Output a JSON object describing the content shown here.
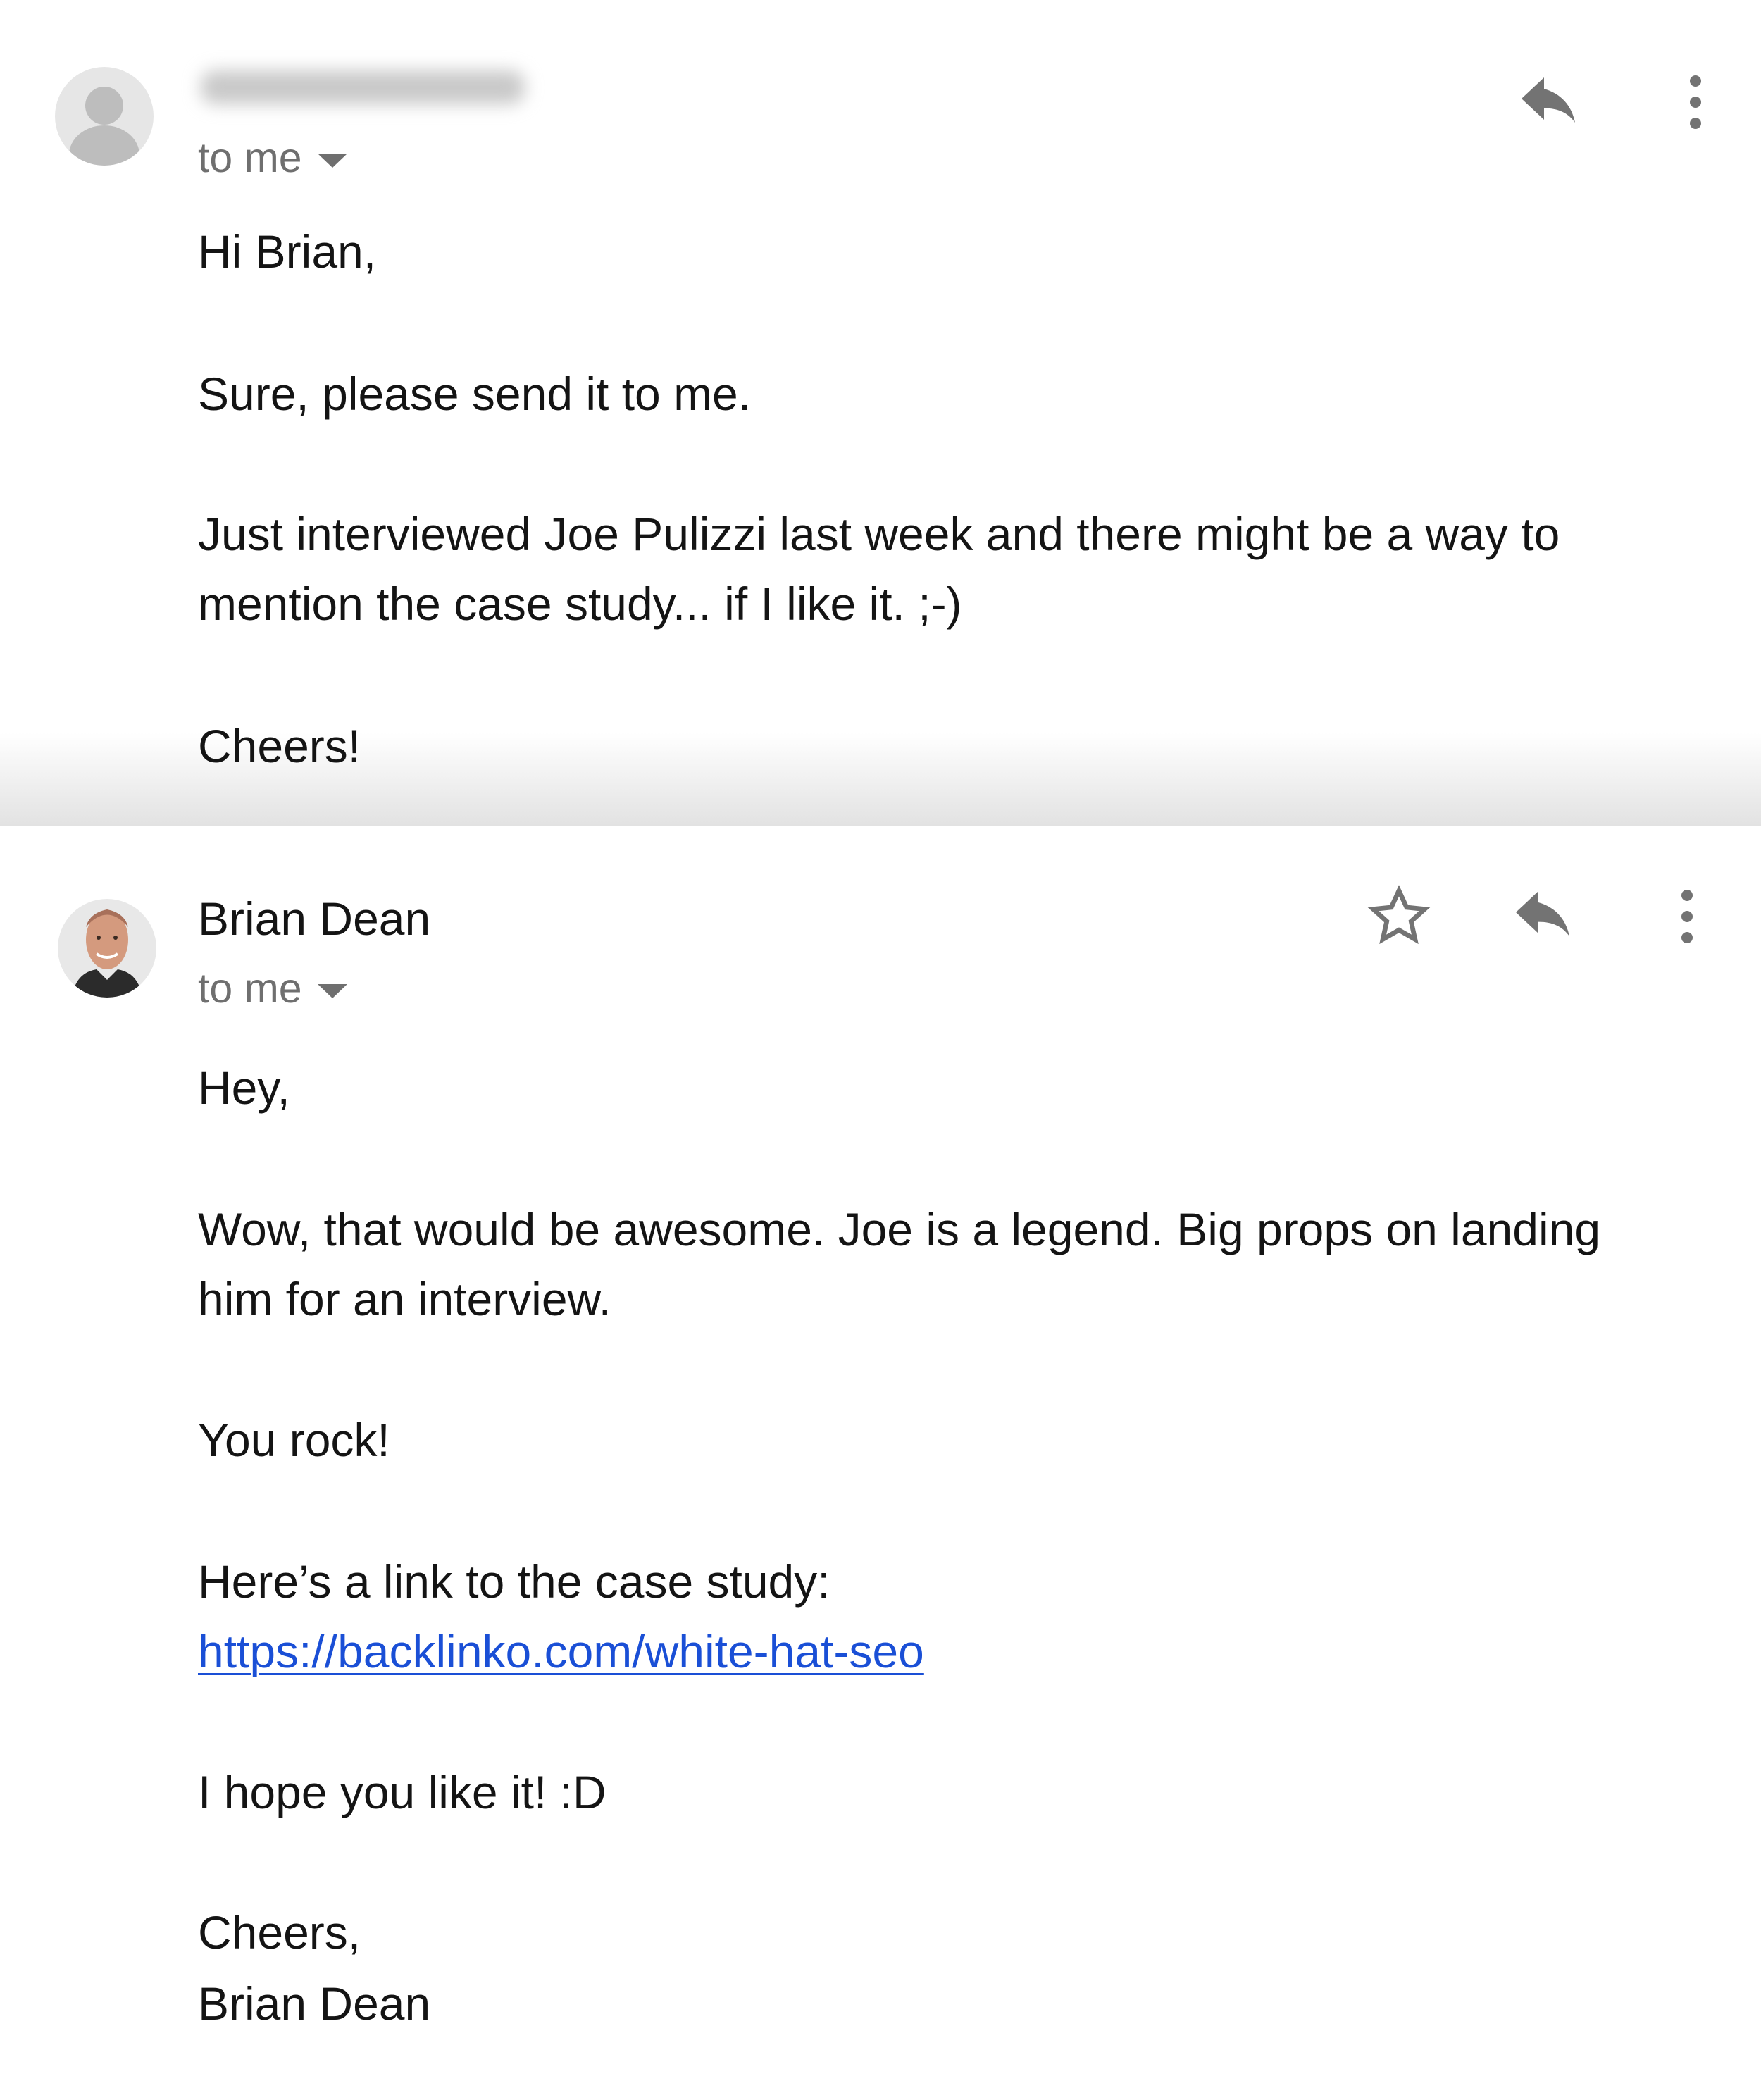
{
  "message1": {
    "sender_name_redacted": true,
    "recipient_label": "to me",
    "body": [
      "Hi Brian,",
      "Sure, please send it to me.",
      "Just interviewed Joe Pulizzi last week and there might be a way to",
      "mention the case study... if I like it. ;-)",
      "Cheers!"
    ],
    "icons": [
      "reply-icon",
      "more-vert-icon"
    ]
  },
  "message2": {
    "sender_name": "Brian Dean",
    "recipient_label": "to me",
    "body": {
      "greeting": "Hey,",
      "p1_line1": "Wow, that would be awesome. Joe is a legend. Big props on landing",
      "p1_line2": "him for an interview.",
      "p2": "You rock!",
      "p3": "Here’s a link to the case study:",
      "link": "https://backlinko.com/white-hat-seo",
      "p4": "I hope you like it! :D",
      "signoff": "Cheers,",
      "signature": "Brian Dean"
    },
    "icons": [
      "star-icon",
      "reply-icon",
      "more-vert-icon"
    ]
  },
  "colors": {
    "link": "#1a4fd6",
    "icon": "#737373",
    "secondary_text": "#6f6f6f"
  }
}
